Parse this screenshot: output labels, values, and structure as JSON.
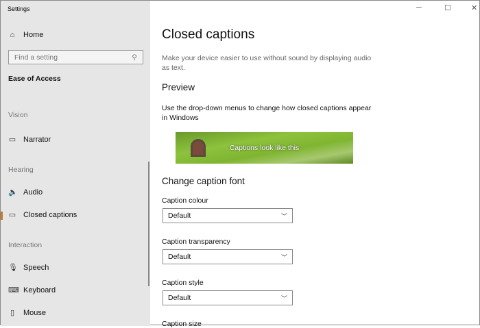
{
  "window": {
    "title": "Settings",
    "minimize": "─",
    "maximize": "☐",
    "close": "✕"
  },
  "sidebar": {
    "home": "Home",
    "search_placeholder": "Find a setting",
    "category": "Ease of Access",
    "sections": [
      {
        "label": "Vision",
        "items": [
          {
            "label": "Narrator",
            "icon": "narrator-icon"
          }
        ]
      },
      {
        "label": "Hearing",
        "items": [
          {
            "label": "Audio",
            "icon": "audio-icon"
          },
          {
            "label": "Closed captions",
            "icon": "closed-captions-icon",
            "selected": true
          }
        ]
      },
      {
        "label": "Interaction",
        "items": [
          {
            "label": "Speech",
            "icon": "microphone-icon"
          },
          {
            "label": "Keyboard",
            "icon": "keyboard-icon"
          },
          {
            "label": "Mouse",
            "icon": "mouse-icon"
          }
        ]
      }
    ]
  },
  "main": {
    "title": "Closed captions",
    "description": "Make your device easier to use without sound by displaying audio as text.",
    "preview_heading": "Preview",
    "preview_text": "Use the drop-down menus to change how closed captions appear in Windows",
    "preview_caption": "Captions look like this",
    "font_heading": "Change caption font",
    "fields": [
      {
        "label": "Caption colour",
        "value": "Default"
      },
      {
        "label": "Caption transparency",
        "value": "Default"
      },
      {
        "label": "Caption style",
        "value": "Default"
      },
      {
        "label": "Caption size"
      }
    ]
  },
  "accent": "#c87a2c"
}
